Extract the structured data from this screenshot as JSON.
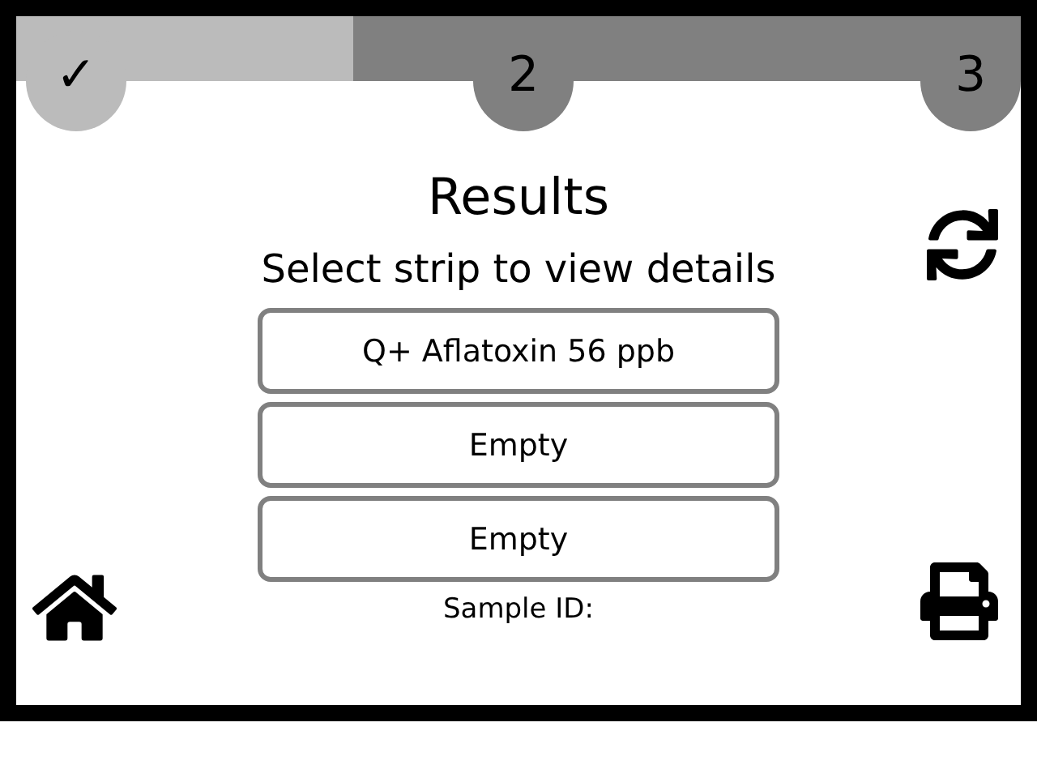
{
  "progress": {
    "level": 0.335,
    "steps": [
      {
        "label": "✓",
        "completed": true
      },
      {
        "label": "2",
        "completed": false
      },
      {
        "label": "3",
        "completed": false
      }
    ]
  },
  "title": "Results",
  "subtitle": "Select strip to view details",
  "strips": [
    {
      "label": "Q+ Aflatoxin 56 ppb"
    },
    {
      "label": "Empty"
    },
    {
      "label": "Empty"
    }
  ],
  "sample_id": {
    "label": "Sample ID:"
  }
}
